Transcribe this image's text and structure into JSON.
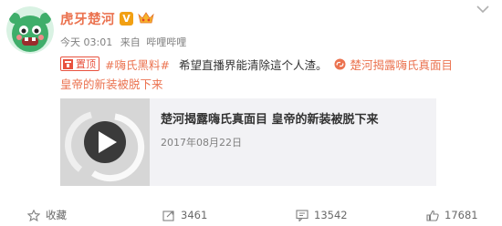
{
  "post": {
    "username": "虎牙楚河",
    "verified_badge": "V",
    "meta": {
      "time": "今天 03:01",
      "source_prefix": "来自",
      "source": "哔哩哔哩"
    },
    "content": {
      "tag_label": "置顶",
      "topic": "#嗨氏黑料#",
      "text": "希望直播界能清除這个人渣。",
      "link_line1": "楚河揭露嗨氏真面目",
      "link_line2": "皇帝的新装被脱下来"
    },
    "media": {
      "title": "楚河揭露嗨氏真面目 皇帝的新装被脱下来",
      "date": "2017年08月22日"
    },
    "actions": {
      "favorite": "收藏",
      "forward": "3461",
      "comment": "13542",
      "like": "17681"
    }
  },
  "colors": {
    "accent": "#eb7350",
    "tag": "#e8523f",
    "badge": "#f2a013",
    "muted": "#808080"
  },
  "icons": [
    "chevron-down-icon",
    "vip-crown-icon",
    "link-icon",
    "play-icon",
    "favorite-icon",
    "forward-icon",
    "comment-icon",
    "like-icon"
  ]
}
